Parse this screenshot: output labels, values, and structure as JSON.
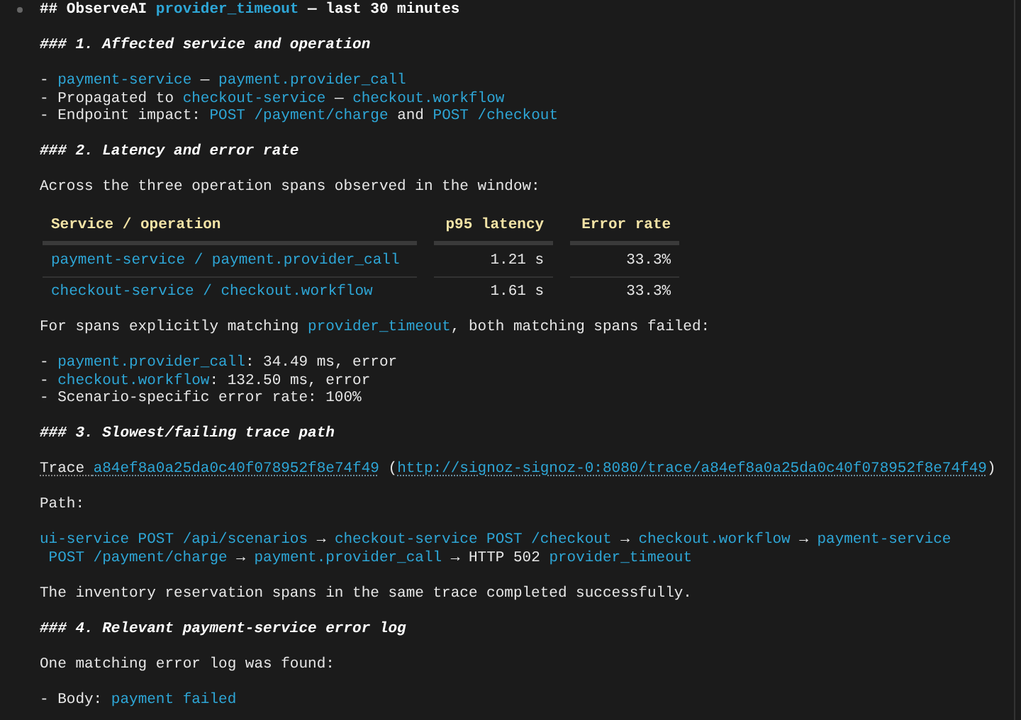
{
  "title": {
    "kind": "h2",
    "segments": [
      {
        "kind": "plain",
        "text": "## ObserveAI "
      },
      {
        "kind": "code",
        "text": "provider_timeout"
      },
      {
        "kind": "plain",
        "text": " — last 30 minutes"
      }
    ]
  },
  "blocks": [
    {
      "kind": "h3",
      "segments": [
        {
          "kind": "plain",
          "text": "### 1. Affected service and operation"
        }
      ]
    },
    {
      "kind": "lines",
      "lines": [
        [
          {
            "kind": "plain",
            "text": "- "
          },
          {
            "kind": "code",
            "text": "payment-service"
          },
          {
            "kind": "plain",
            "text": " — "
          },
          {
            "kind": "code",
            "text": "payment.provider_call"
          }
        ],
        [
          {
            "kind": "plain",
            "text": "- Propagated to "
          },
          {
            "kind": "code",
            "text": "checkout-service"
          },
          {
            "kind": "plain",
            "text": " — "
          },
          {
            "kind": "code",
            "text": "checkout.workflow"
          }
        ],
        [
          {
            "kind": "plain",
            "text": "- Endpoint impact: "
          },
          {
            "kind": "code",
            "text": "POST /payment/charge"
          },
          {
            "kind": "plain",
            "text": " and "
          },
          {
            "kind": "code",
            "text": "POST /checkout"
          }
        ]
      ]
    },
    {
      "kind": "h3",
      "segments": [
        {
          "kind": "plain",
          "text": "### 2. Latency and error rate"
        }
      ]
    },
    {
      "kind": "para",
      "segments": [
        {
          "kind": "plain",
          "text": "Across the three operation spans observed in the window:"
        }
      ]
    },
    {
      "kind": "table",
      "columns": [
        "Service / operation",
        "p95 latency",
        "Error rate"
      ],
      "rows": [
        [
          "payment-service / payment.provider_call",
          "1.21 s",
          "33.3%"
        ],
        [
          "checkout-service / checkout.workflow",
          "1.61 s",
          "33.3%"
        ]
      ]
    },
    {
      "kind": "para",
      "segments": [
        {
          "kind": "plain",
          "text": "For spans explicitly matching "
        },
        {
          "kind": "code",
          "text": "provider_timeout"
        },
        {
          "kind": "plain",
          "text": ", both matching spans failed:"
        }
      ]
    },
    {
      "kind": "lines",
      "lines": [
        [
          {
            "kind": "plain",
            "text": "- "
          },
          {
            "kind": "code",
            "text": "payment.provider_call"
          },
          {
            "kind": "plain",
            "text": ": 34.49 ms, error"
          }
        ],
        [
          {
            "kind": "plain",
            "text": "- "
          },
          {
            "kind": "code",
            "text": "checkout.workflow"
          },
          {
            "kind": "plain",
            "text": ": 132.50 ms, error"
          }
        ],
        [
          {
            "kind": "plain",
            "text": "- Scenario-specific error rate: 100%"
          }
        ]
      ]
    },
    {
      "kind": "h3",
      "segments": [
        {
          "kind": "plain",
          "text": "### 3. Slowest/failing trace path"
        }
      ]
    },
    {
      "kind": "para",
      "segments": [
        {
          "kind": "abbr",
          "text": "Trace "
        },
        {
          "kind": "link",
          "text": "a84ef8a0a25da0c40f078952f8e74f49"
        },
        {
          "kind": "plain",
          "text": " ("
        },
        {
          "kind": "link",
          "text": "http://signoz-signoz-0:8080/trace/a84ef8a0a25da0c40f078952f8e74f49"
        },
        {
          "kind": "plain",
          "text": ")"
        }
      ]
    },
    {
      "kind": "para",
      "segments": [
        {
          "kind": "plain",
          "text": "Path:"
        }
      ]
    },
    {
      "kind": "para",
      "segments": [
        {
          "kind": "code",
          "text": "ui-service POST /api/scenarios"
        },
        {
          "kind": "plain",
          "text": " → "
        },
        {
          "kind": "code",
          "text": "checkout-service POST /checkout"
        },
        {
          "kind": "plain",
          "text": " → "
        },
        {
          "kind": "code",
          "text": "checkout.workflow"
        },
        {
          "kind": "plain",
          "text": " → "
        },
        {
          "kind": "code",
          "text": "payment-service"
        },
        {
          "kind": "code",
          "text": "POST /payment/charge"
        },
        {
          "kind": "plain",
          "text": " → "
        },
        {
          "kind": "code",
          "text": "payment.provider_call"
        },
        {
          "kind": "plain",
          "text": " → HTTP 502 "
        },
        {
          "kind": "code",
          "text": "provider_timeout"
        }
      ]
    },
    {
      "kind": "para",
      "segments": [
        {
          "kind": "plain",
          "text": "The inventory reservation spans in the same trace completed successfully."
        }
      ]
    },
    {
      "kind": "h3",
      "segments": [
        {
          "kind": "plain",
          "text": "### 4. Relevant payment-service error log"
        }
      ]
    },
    {
      "kind": "para",
      "segments": [
        {
          "kind": "plain",
          "text": "One matching error log was found:"
        }
      ]
    },
    {
      "kind": "lines",
      "lines": [
        [
          {
            "kind": "plain",
            "text": "- Body: "
          },
          {
            "kind": "code",
            "text": "payment failed"
          }
        ]
      ]
    }
  ]
}
